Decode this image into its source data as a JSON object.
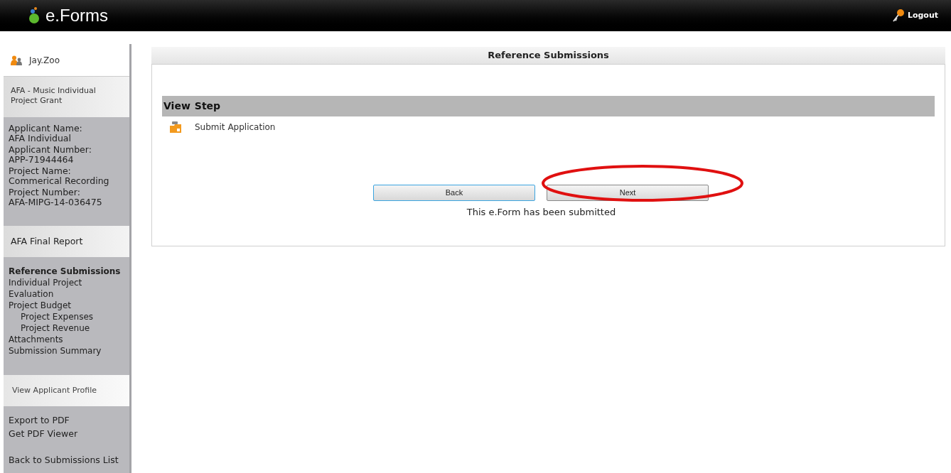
{
  "header": {
    "logo": "e.Forms",
    "logout": "Logout"
  },
  "sidebar": {
    "user": "Jay.Zoo",
    "program": "AFA - Music Individual Project Grant",
    "info": [
      {
        "label": "Applicant Name:",
        "value": "AFA Individual"
      },
      {
        "label": "Applicant Number:",
        "value": "APP-71944464"
      },
      {
        "label": "Project Name:",
        "value": "Commerical Recording"
      },
      {
        "label": "Project Number:",
        "value": "AFA-MIPG-14-036475"
      }
    ],
    "form": "AFA Final Report",
    "nav": [
      {
        "label": "Reference Submissions",
        "selected": true
      },
      {
        "label": "Individual Project Evaluation",
        "selected": false
      },
      {
        "label": "Project Budget",
        "selected": false,
        "children": [
          {
            "label": "Project Expenses",
            "selected": false
          },
          {
            "label": "Project Revenue",
            "selected": false
          }
        ]
      },
      {
        "label": "Attachments",
        "selected": false
      },
      {
        "label": "Submission Summary",
        "selected": false
      }
    ],
    "profile_link": "View Applicant Profile",
    "links": [
      "Export to PDF",
      "Get PDF Viewer"
    ],
    "back_link": "Back to Submissions List"
  },
  "main": {
    "title": "Reference Submissions",
    "table": {
      "columns": [
        "View",
        "Step"
      ],
      "rows": [
        {
          "step": "Submit Application"
        }
      ]
    },
    "buttons": [
      {
        "label": "Back",
        "focused": true
      },
      {
        "label": "Next",
        "focused": false
      }
    ],
    "status": "This e.Form has been submitted"
  }
}
